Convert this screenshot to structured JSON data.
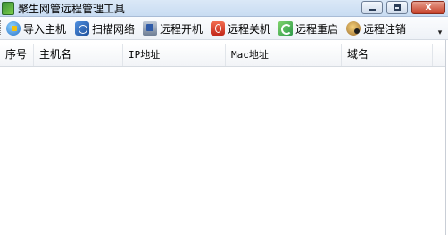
{
  "window": {
    "title": "聚生网管远程管理工具",
    "min_glyph": "",
    "max_glyph": "",
    "close_glyph": "x"
  },
  "toolbar": {
    "items": [
      {
        "label": "导入主机",
        "icon": "globe-import-icon"
      },
      {
        "label": "扫描网络",
        "icon": "network-scan-icon"
      },
      {
        "label": "远程开机",
        "icon": "power-on-icon"
      },
      {
        "label": "远程关机",
        "icon": "power-off-icon"
      },
      {
        "label": "远程重启",
        "icon": "restart-icon"
      },
      {
        "label": "远程注销",
        "icon": "logoff-icon"
      }
    ],
    "overflow_glyph": "▾"
  },
  "list": {
    "columns": [
      "序号",
      "主机名",
      "IP地址",
      "Mac地址",
      "域名"
    ],
    "rows": []
  }
}
